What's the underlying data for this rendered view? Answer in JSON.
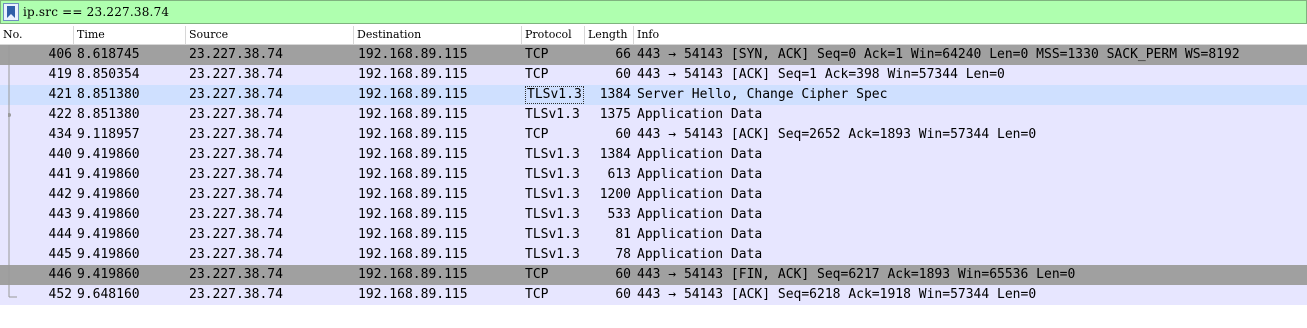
{
  "filter": {
    "value": "ip.src == 23.227.38.74"
  },
  "columns": [
    "No.",
    "Time",
    "Source",
    "Destination",
    "Protocol",
    "Length",
    "Info"
  ],
  "colors": {
    "filter_bg": "#afffaf",
    "tcp_row": "#e7e6ff",
    "flag_row": "#a0a0a0",
    "selected_row": "#cfe0ff"
  },
  "packets": [
    {
      "no": "406",
      "time": "8.618745",
      "src": "23.227.38.74",
      "dst": "192.168.89.115",
      "proto": "TCP",
      "len": "66",
      "info": "443 → 54143 [SYN, ACK] Seq=0 Ack=1 Win=64240 Len=0 MSS=1330 SACK_PERM WS=8192",
      "style": "gray"
    },
    {
      "no": "419",
      "time": "8.850354",
      "src": "23.227.38.74",
      "dst": "192.168.89.115",
      "proto": "TCP",
      "len": "60",
      "info": "443 → 54143 [ACK] Seq=1 Ack=398 Win=57344 Len=0",
      "style": "tcp"
    },
    {
      "no": "421",
      "time": "8.851380",
      "src": "23.227.38.74",
      "dst": "192.168.89.115",
      "proto": "TLSv1.3",
      "len": "1384",
      "info": "Server Hello, Change Cipher Spec",
      "style": "selected"
    },
    {
      "no": "422",
      "time": "8.851380",
      "src": "23.227.38.74",
      "dst": "192.168.89.115",
      "proto": "TLSv1.3",
      "len": "1375",
      "info": "Application Data",
      "style": "tcp"
    },
    {
      "no": "434",
      "time": "9.118957",
      "src": "23.227.38.74",
      "dst": "192.168.89.115",
      "proto": "TCP",
      "len": "60",
      "info": "443 → 54143 [ACK] Seq=2652 Ack=1893 Win=57344 Len=0",
      "style": "tcp"
    },
    {
      "no": "440",
      "time": "9.419860",
      "src": "23.227.38.74",
      "dst": "192.168.89.115",
      "proto": "TLSv1.3",
      "len": "1384",
      "info": "Application Data",
      "style": "tcp"
    },
    {
      "no": "441",
      "time": "9.419860",
      "src": "23.227.38.74",
      "dst": "192.168.89.115",
      "proto": "TLSv1.3",
      "len": "613",
      "info": "Application Data",
      "style": "tcp"
    },
    {
      "no": "442",
      "time": "9.419860",
      "src": "23.227.38.74",
      "dst": "192.168.89.115",
      "proto": "TLSv1.3",
      "len": "1200",
      "info": "Application Data",
      "style": "tcp"
    },
    {
      "no": "443",
      "time": "9.419860",
      "src": "23.227.38.74",
      "dst": "192.168.89.115",
      "proto": "TLSv1.3",
      "len": "533",
      "info": "Application Data",
      "style": "tcp"
    },
    {
      "no": "444",
      "time": "9.419860",
      "src": "23.227.38.74",
      "dst": "192.168.89.115",
      "proto": "TLSv1.3",
      "len": "81",
      "info": "Application Data",
      "style": "tcp"
    },
    {
      "no": "445",
      "time": "9.419860",
      "src": "23.227.38.74",
      "dst": "192.168.89.115",
      "proto": "TLSv1.3",
      "len": "78",
      "info": "Application Data",
      "style": "tcp"
    },
    {
      "no": "446",
      "time": "9.419860",
      "src": "23.227.38.74",
      "dst": "192.168.89.115",
      "proto": "TCP",
      "len": "60",
      "info": "443 → 54143 [FIN, ACK] Seq=6217 Ack=1893 Win=65536 Len=0",
      "style": "gray"
    },
    {
      "no": "452",
      "time": "9.648160",
      "src": "23.227.38.74",
      "dst": "192.168.89.115",
      "proto": "TCP",
      "len": "60",
      "info": "443 → 54143 [ACK] Seq=6218 Ack=1918 Win=57344 Len=0",
      "style": "tcp"
    }
  ]
}
